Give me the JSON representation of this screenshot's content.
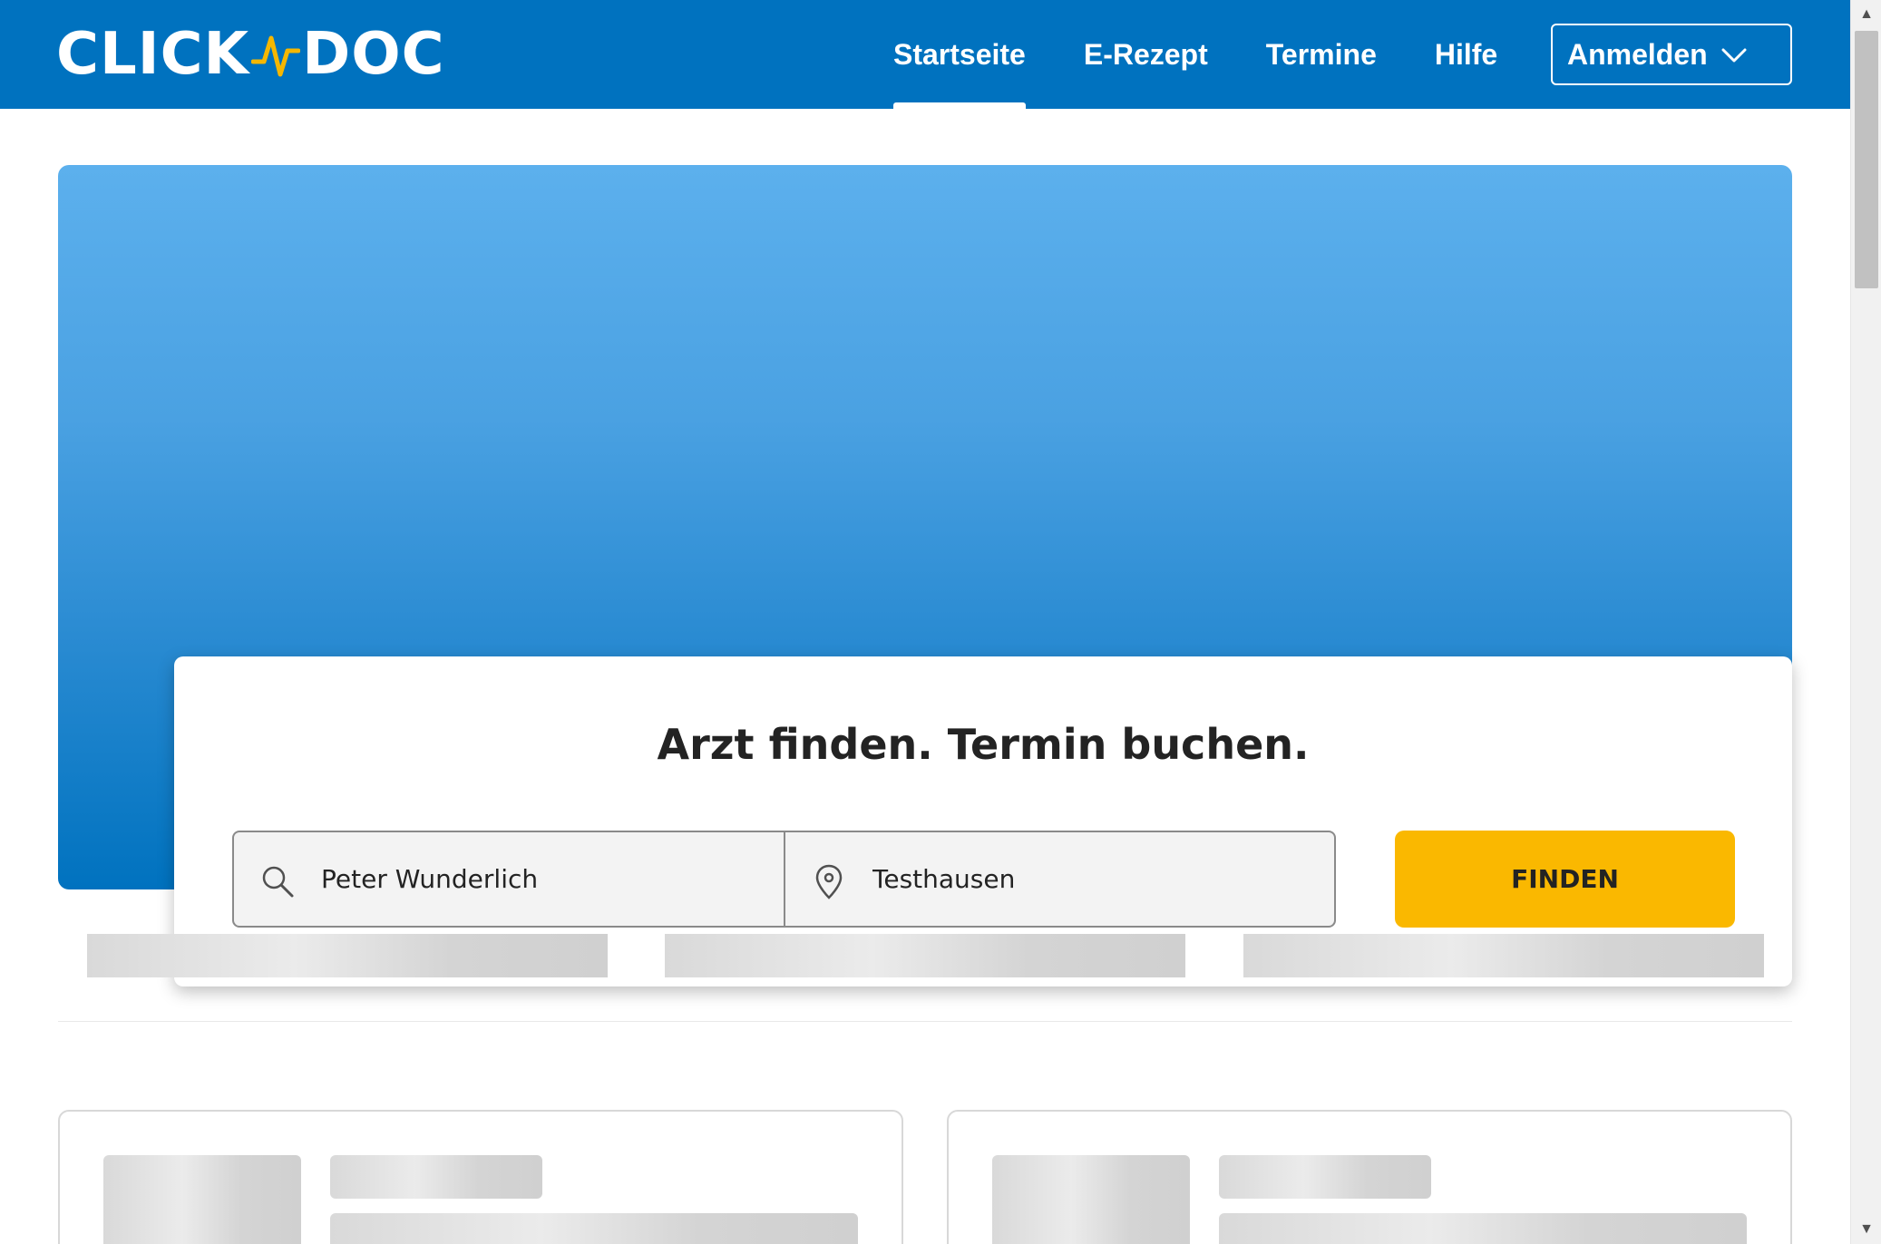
{
  "header": {
    "brand_left": "CLICK",
    "brand_right": "DOC",
    "nav": [
      {
        "label": "Startseite",
        "active": true
      },
      {
        "label": "E-Rezept",
        "active": false
      },
      {
        "label": "Termine",
        "active": false
      },
      {
        "label": "Hilfe",
        "active": false
      }
    ],
    "login_label": "Anmelden"
  },
  "search": {
    "title": "Arzt finden. Termin buchen.",
    "what_value": "Peter Wunderlich",
    "where_value": "Testhausen",
    "find_label": "FINDEN"
  },
  "colors": {
    "brand_blue": "#0072bf",
    "accent_yellow": "#fab800",
    "logo_wave": "#f5b700"
  },
  "icons": {
    "search": "search-icon",
    "location": "location-pin-icon",
    "dropdown": "chevron-down-icon"
  }
}
